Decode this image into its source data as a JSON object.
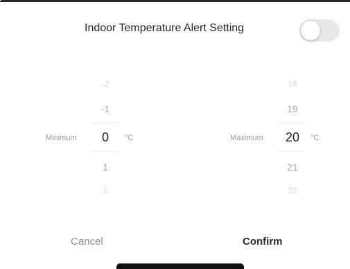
{
  "header": {
    "title": "Indoor Temperature Alert Setting",
    "toggle_on": false
  },
  "minimum": {
    "label": "Minimum",
    "unit": "°C",
    "values_above": [
      "-2",
      "-1"
    ],
    "selected": "0",
    "values_below": [
      "1",
      "2"
    ]
  },
  "maximum": {
    "label": "Maximum",
    "unit": "°C",
    "value_top": "·",
    "values_above": [
      "18",
      "19"
    ],
    "selected": "20",
    "values_below": [
      "21",
      "22"
    ]
  },
  "actions": {
    "cancel": "Cancel",
    "confirm": "Confirm"
  },
  "colors": {
    "toggle_off_track": "#e9e9eb",
    "text_primary": "#262626",
    "text_muted": "#8e8e8e"
  }
}
